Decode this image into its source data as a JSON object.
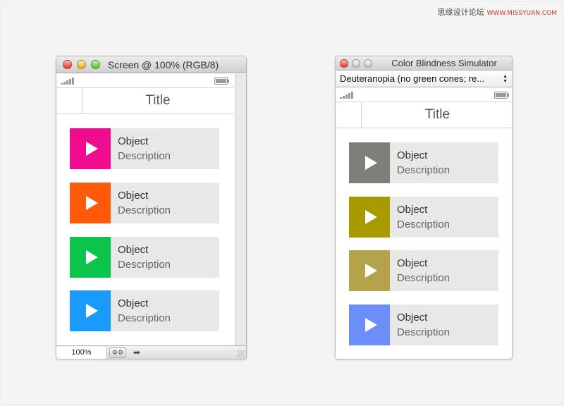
{
  "watermark": {
    "cn": "思缘设计论坛",
    "url": "WWW.MISSYUAN.COM"
  },
  "left_window": {
    "title": "Screen @ 100% (RGB/8)",
    "nav_title": "Title",
    "items": [
      {
        "label": "Object",
        "description": "Description",
        "color": "#f00c8e"
      },
      {
        "label": "Object",
        "description": "Description",
        "color": "#ff5a0a"
      },
      {
        "label": "Object",
        "description": "Description",
        "color": "#0bc44c"
      },
      {
        "label": "Object",
        "description": "Description",
        "color": "#1a9bfb"
      }
    ],
    "zoom": "100%"
  },
  "right_window": {
    "title": "Color Blindness Simulator",
    "mode_select": "Deuteranopia (no green cones; re...",
    "nav_title": "Title",
    "items": [
      {
        "label": "Object",
        "description": "Description",
        "color": "#7f7f79"
      },
      {
        "label": "Object",
        "description": "Description",
        "color": "#a89a00"
      },
      {
        "label": "Object",
        "description": "Description",
        "color": "#b3a44c"
      },
      {
        "label": "Object",
        "description": "Description",
        "color": "#6b8efa"
      }
    ]
  },
  "icons": [
    "signal-icon",
    "battery-icon",
    "play-icon",
    "gear-icon",
    "share-icon",
    "resize-grip-icon"
  ]
}
